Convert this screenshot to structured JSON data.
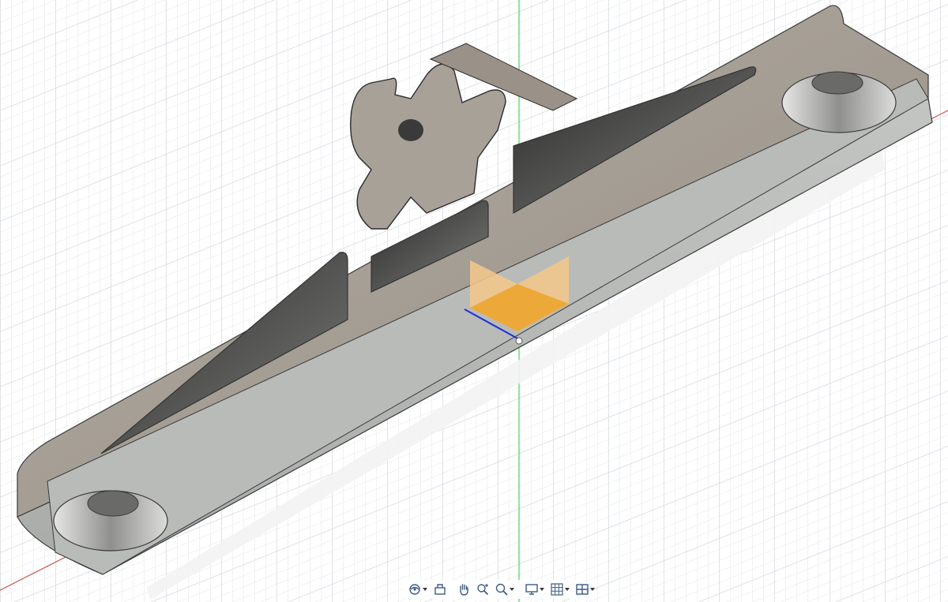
{
  "viewport": {
    "background": "#ffffff",
    "grid_minor": "#e4e6ea",
    "grid_major": "#cfd3d9",
    "axis_x_color": "#c0392b",
    "axis_y_color": "#2ecc40",
    "axis_z_color": "#1f2fd1",
    "body_top_color": "#a39b91",
    "body_side_color": "#b4b6b4",
    "body_edge_color": "#3a3a3a",
    "viewcube_color": "#f5a623"
  },
  "navigation_bar": {
    "tools": [
      {
        "name": "orbit-icon",
        "has_menu": true
      },
      {
        "name": "look-at-icon",
        "has_menu": false
      },
      {
        "name": "pan-hand-icon",
        "has_menu": false
      },
      {
        "name": "zoom-icon",
        "has_menu": false
      },
      {
        "name": "zoom-window-icon",
        "has_menu": true
      },
      {
        "name": "display-settings-icon",
        "has_menu": true
      },
      {
        "name": "grid-snaps-icon",
        "has_menu": true
      },
      {
        "name": "viewports-icon",
        "has_menu": true
      }
    ]
  }
}
